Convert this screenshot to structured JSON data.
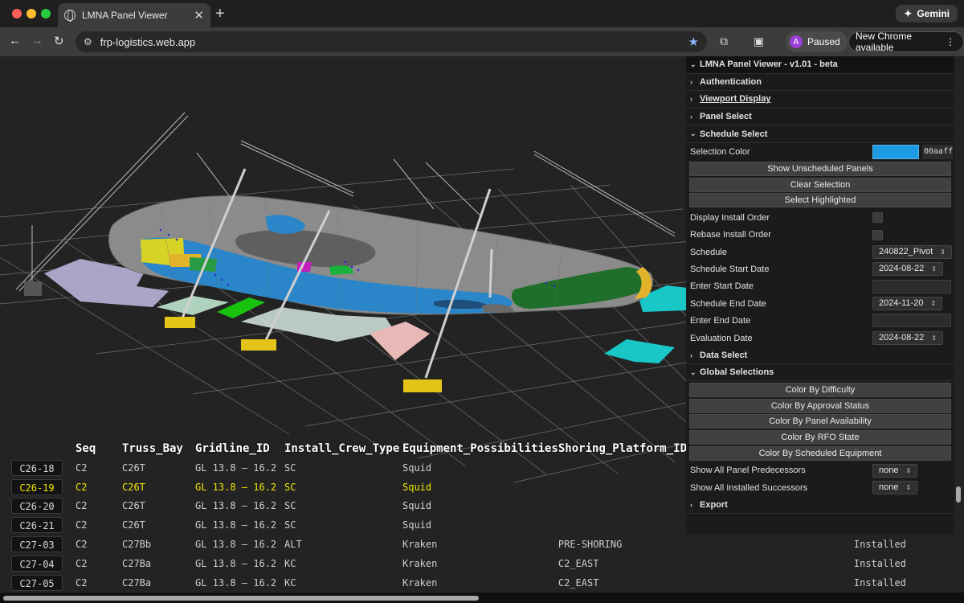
{
  "browser": {
    "tab_title": "LMNA Panel Viewer",
    "gemini_label": "Gemini",
    "url": "frp-logistics.web.app",
    "profile_initial": "A",
    "profile_label": "Paused",
    "update_label": "New Chrome available"
  },
  "panel": {
    "title": "LMNA Panel Viewer - v1.01 - beta",
    "sections": {
      "authentication": "Authentication",
      "viewport_display": "Viewport Display",
      "panel_select": "Panel Select",
      "schedule_select": "Schedule Select",
      "data_select": "Data Select",
      "global_selections": "Global Selections",
      "export": "Export"
    },
    "schedule": {
      "selection_color_label": "Selection Color",
      "selection_color_value": "#1c9ae4",
      "selection_color_hex": "00aaff",
      "show_unscheduled": "Show Unscheduled Panels",
      "clear_selection": "Clear Selection",
      "select_highlighted": "Select Highlighted",
      "display_install_order": "Display Install Order",
      "rebase_install_order": "Rebase Install Order",
      "schedule_label": "Schedule",
      "schedule_value": "240822_Pivot",
      "start_date_label": "Schedule Start Date",
      "start_date_value": "2024-08-22",
      "enter_start_label": "Enter Start Date",
      "end_date_label": "Schedule End Date",
      "end_date_value": "2024-11-20",
      "enter_end_label": "Enter End Date",
      "eval_date_label": "Evaluation Date",
      "eval_date_value": "2024-08-22"
    },
    "global": {
      "color_by_difficulty": "Color By Difficulty",
      "color_by_approval": "Color By Approval Status",
      "color_by_availability": "Color By Panel Availability",
      "color_by_rfo": "Color By RFO State",
      "color_by_equipment": "Color By Scheduled Equipment",
      "predecessors_label": "Show All Panel Predecessors",
      "predecessors_value": "none",
      "successors_label": "Show All Installed Successors",
      "successors_value": "none"
    }
  },
  "table": {
    "columns": [
      "Seq",
      "Truss_Bay",
      "Gridline_ID",
      "Install_Crew_Type",
      "Equipment_Possibilities",
      "Shoring_Platform_ID"
    ],
    "rows": [
      {
        "id": "C26-18",
        "seq": "C2",
        "bay": "C26T",
        "grid": "GL 13.8 – 16.2",
        "crew": "SC",
        "equip": "Squid",
        "shoring": "",
        "status": "",
        "highlight": false
      },
      {
        "id": "C26-19",
        "seq": "C2",
        "bay": "C26T",
        "grid": "GL 13.8 – 16.2",
        "crew": "SC",
        "equip": "Squid",
        "shoring": "",
        "status": "",
        "highlight": true
      },
      {
        "id": "C26-20",
        "seq": "C2",
        "bay": "C26T",
        "grid": "GL 13.8 – 16.2",
        "crew": "SC",
        "equip": "Squid",
        "shoring": "",
        "status": "",
        "highlight": false
      },
      {
        "id": "C26-21",
        "seq": "C2",
        "bay": "C26T",
        "grid": "GL 13.8 – 16.2",
        "crew": "SC",
        "equip": "Squid",
        "shoring": "",
        "status": "",
        "highlight": false
      },
      {
        "id": "C27-03",
        "seq": "C2",
        "bay": "C27Bb",
        "grid": "GL 13.8 – 16.2",
        "crew": "ALT",
        "equip": "Kraken",
        "shoring": "PRE-SHORING",
        "status": "Installed",
        "highlight": false
      },
      {
        "id": "C27-04",
        "seq": "C2",
        "bay": "C27Ba",
        "grid": "GL 13.8 – 16.2",
        "crew": "KC",
        "equip": "Kraken",
        "shoring": "C2_EAST",
        "status": "Installed",
        "highlight": false
      },
      {
        "id": "C27-05",
        "seq": "C2",
        "bay": "C27Ba",
        "grid": "GL 13.8 – 16.2",
        "crew": "KC",
        "equip": "Kraken",
        "shoring": "C2_EAST",
        "status": "Installed",
        "highlight": false
      }
    ]
  }
}
